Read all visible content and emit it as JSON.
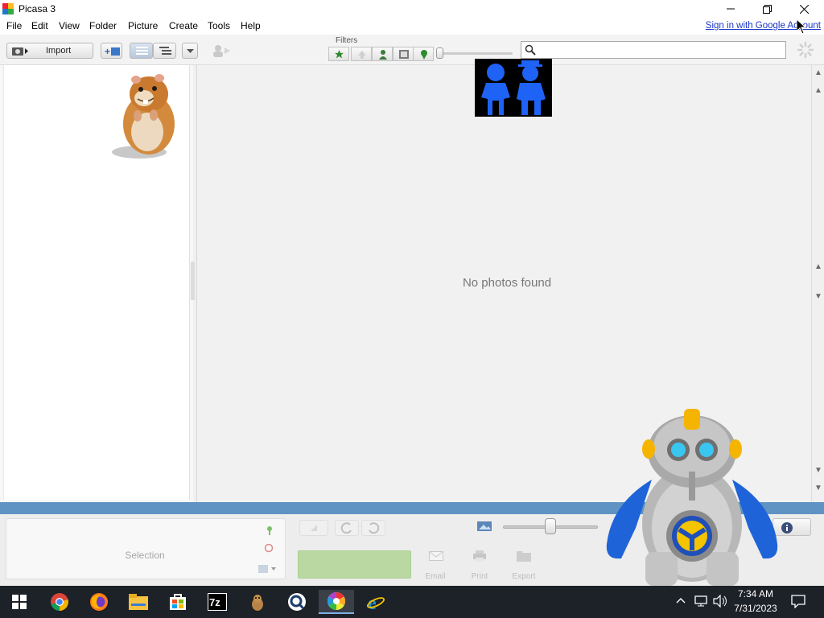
{
  "window": {
    "title": "Picasa 3",
    "controls": [
      "minimize",
      "restore",
      "close"
    ]
  },
  "menu": {
    "items": [
      "File",
      "Edit",
      "View",
      "Folder",
      "Picture",
      "Create",
      "Tools",
      "Help"
    ],
    "signin_link": "Sign in with Google Account"
  },
  "toolbar": {
    "import_label": "Import",
    "filters_label": "Filters",
    "filter_buttons": [
      "star-icon",
      "upload-icon",
      "person-icon",
      "movie-icon",
      "geotag-icon"
    ],
    "search_value": "",
    "search_placeholder": ""
  },
  "main": {
    "empty_message": "No photos found"
  },
  "tray": {
    "selection_label": "Selection",
    "actions": [
      "Email",
      "Print",
      "Export"
    ]
  },
  "taskbar": {
    "apps": [
      "Start",
      "Google Chrome",
      "Firefox",
      "File Explorer",
      "Microsoft Store",
      "7-Zip",
      "Picasa Tool",
      "Search App",
      "Picasa 3",
      "Internet Explorer"
    ],
    "time": "7:34 AM",
    "date": "7/31/2023"
  },
  "colors": {
    "accent_blue": "#5f93c4",
    "link_blue": "#1a35c8",
    "upload_green": "#a9d38a",
    "taskbar_bg": "#1d2128"
  }
}
